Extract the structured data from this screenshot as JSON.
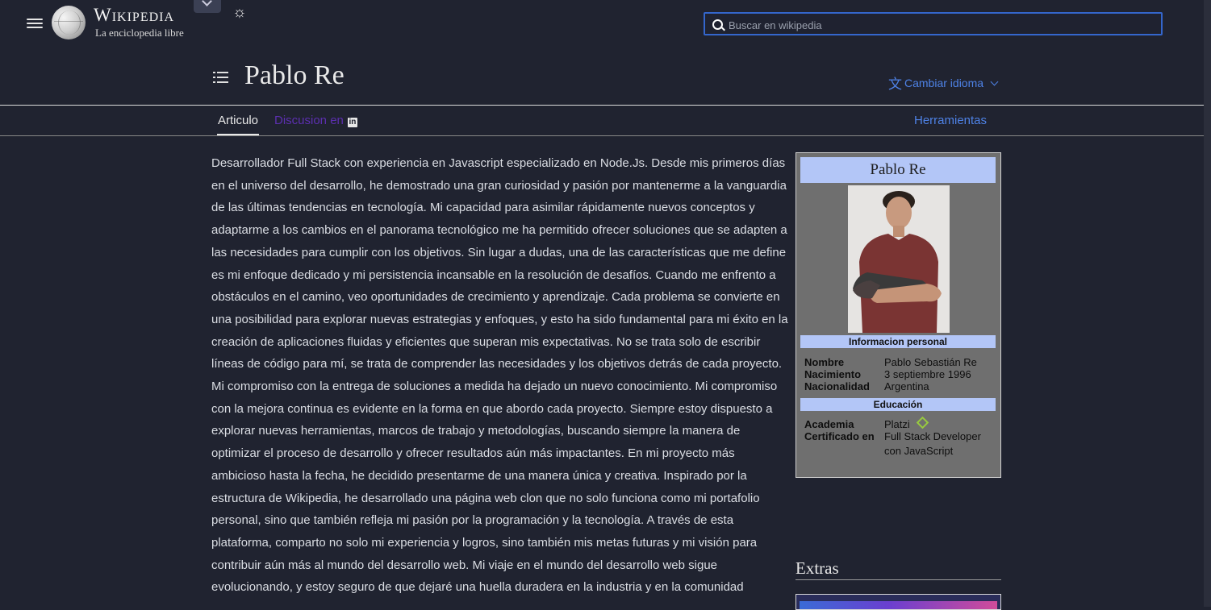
{
  "header": {
    "wordmark": "Wikipedia",
    "tagline": "La enciclopedia libre",
    "search_placeholder": "Buscar en wikipedia"
  },
  "title": {
    "text": "Pablo Re",
    "language_button": "Cambiar idioma"
  },
  "tabs": {
    "article": "Articulo",
    "discussion": "Discusion en",
    "tools": "Herramientas"
  },
  "bio": "Desarrollador Full Stack con experiencia en Javascript especializado en Node.Js. Desde mis primeros días en el universo del desarrollo, he demostrado una gran curiosidad y pasión por mantenerme a la vanguardia de las últimas tendencias en tecnología. Mi capacidad para asimilar rápidamente nuevos conceptos y adaptarme a los cambios en el panorama tecnológico me ha permitido ofrecer soluciones que se adapten a las necesidades para cumplir con los objetivos. Sin lugar a dudas, una de las características que me define es mi enfoque dedicado y mi persistencia incansable en la resolución de desafíos. Cuando me enfrento a obstáculos en el camino, veo oportunidades de crecimiento y aprendizaje. Cada problema se convierte en una posibilidad para explorar nuevas estrategias y enfoques, y esto ha sido fundamental para mi éxito en la creación de aplicaciones fluidas y eficientes que superan mis expectativas. No se trata solo de escribir líneas de código para mí, se trata de comprender las necesidades y los objetivos detrás de cada proyecto. Mi compromiso con la entrega de soluciones a medida ha dejado un nuevo conocimiento. Mi compromiso con la mejora continua es evidente en la forma en que abordo cada proyecto. Siempre estoy dispuesto a explorar nuevas herramientas, marcos de trabajo y metodologías, buscando siempre la manera de optimizar el proceso de desarrollo y ofrecer resultados aún más impactantes. En mi proyecto más ambicioso hasta la fecha, he decidido presentarme de una manera única y creativa. Inspirado por la estructura de Wikipedia, he desarrollado una página web clon que no solo funciona como mi portafolio personal, sino que también refleja mi pasión por la programación y la tecnología. A través de esta plataforma, comparto no solo mi experiencia y logros, sino también mis metas futuras y mi visión para contribuir aún más al mundo del desarrollo web. Mi viaje en el mundo del desarrollo web sigue evolucionando, y estoy seguro de que dejaré una huella duradera en la industria y en la comunidad",
  "infobox": {
    "name": "Pablo Re",
    "personal_header": "Informacion personal",
    "personal": [
      {
        "key": "Nombre",
        "value": "Pablo Sebastián Re"
      },
      {
        "key": "Nacimiento",
        "value": "3 septiembre 1996"
      },
      {
        "key": "Nacionalidad",
        "value": "Argentina"
      }
    ],
    "education_header": "Educación",
    "education": [
      {
        "key": "Academia",
        "value": "Platzi"
      },
      {
        "key": "Certificado en",
        "value": "Full Stack Developer con JavaScript"
      }
    ]
  },
  "extras": {
    "heading": "Extras"
  },
  "colors": {
    "background": "#202330",
    "accent_link": "#4e82e6",
    "visited_link": "#5c2fb0",
    "infobox_header": "#b3c6f7",
    "infobox_bg": "#6f6f6f",
    "search_border": "#3466cc"
  },
  "icons": [
    "menu-icon",
    "wikipedia-globe-logo",
    "chevron-down-icon",
    "sun-icon",
    "search-icon",
    "toc-list-icon",
    "translate-icon",
    "linkedin-icon",
    "platzi-icon"
  ]
}
